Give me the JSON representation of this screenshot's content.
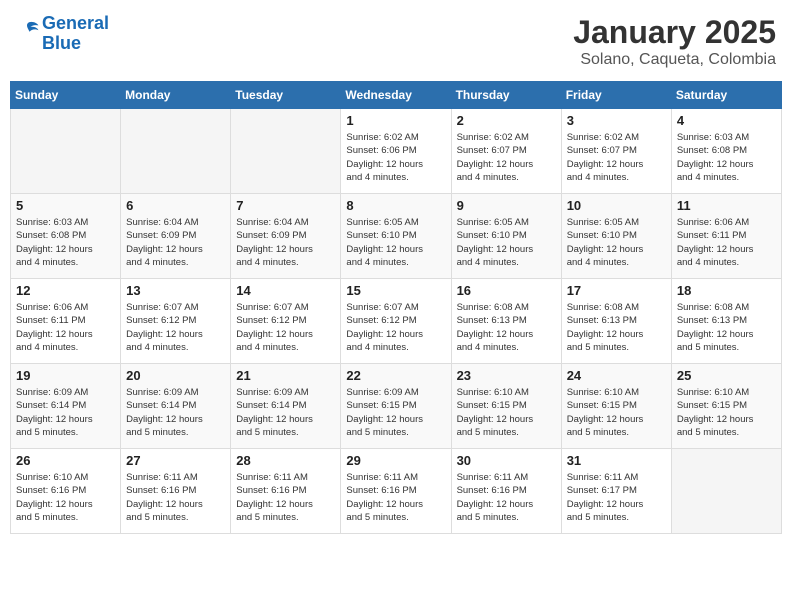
{
  "logo": {
    "line1": "General",
    "line2": "Blue"
  },
  "title": "January 2025",
  "location": "Solano, Caqueta, Colombia",
  "weekdays": [
    "Sunday",
    "Monday",
    "Tuesday",
    "Wednesday",
    "Thursday",
    "Friday",
    "Saturday"
  ],
  "weeks": [
    [
      {
        "day": "",
        "info": ""
      },
      {
        "day": "",
        "info": ""
      },
      {
        "day": "",
        "info": ""
      },
      {
        "day": "1",
        "info": "Sunrise: 6:02 AM\nSunset: 6:06 PM\nDaylight: 12 hours\nand 4 minutes."
      },
      {
        "day": "2",
        "info": "Sunrise: 6:02 AM\nSunset: 6:07 PM\nDaylight: 12 hours\nand 4 minutes."
      },
      {
        "day": "3",
        "info": "Sunrise: 6:02 AM\nSunset: 6:07 PM\nDaylight: 12 hours\nand 4 minutes."
      },
      {
        "day": "4",
        "info": "Sunrise: 6:03 AM\nSunset: 6:08 PM\nDaylight: 12 hours\nand 4 minutes."
      }
    ],
    [
      {
        "day": "5",
        "info": "Sunrise: 6:03 AM\nSunset: 6:08 PM\nDaylight: 12 hours\nand 4 minutes."
      },
      {
        "day": "6",
        "info": "Sunrise: 6:04 AM\nSunset: 6:09 PM\nDaylight: 12 hours\nand 4 minutes."
      },
      {
        "day": "7",
        "info": "Sunrise: 6:04 AM\nSunset: 6:09 PM\nDaylight: 12 hours\nand 4 minutes."
      },
      {
        "day": "8",
        "info": "Sunrise: 6:05 AM\nSunset: 6:10 PM\nDaylight: 12 hours\nand 4 minutes."
      },
      {
        "day": "9",
        "info": "Sunrise: 6:05 AM\nSunset: 6:10 PM\nDaylight: 12 hours\nand 4 minutes."
      },
      {
        "day": "10",
        "info": "Sunrise: 6:05 AM\nSunset: 6:10 PM\nDaylight: 12 hours\nand 4 minutes."
      },
      {
        "day": "11",
        "info": "Sunrise: 6:06 AM\nSunset: 6:11 PM\nDaylight: 12 hours\nand 4 minutes."
      }
    ],
    [
      {
        "day": "12",
        "info": "Sunrise: 6:06 AM\nSunset: 6:11 PM\nDaylight: 12 hours\nand 4 minutes."
      },
      {
        "day": "13",
        "info": "Sunrise: 6:07 AM\nSunset: 6:12 PM\nDaylight: 12 hours\nand 4 minutes."
      },
      {
        "day": "14",
        "info": "Sunrise: 6:07 AM\nSunset: 6:12 PM\nDaylight: 12 hours\nand 4 minutes."
      },
      {
        "day": "15",
        "info": "Sunrise: 6:07 AM\nSunset: 6:12 PM\nDaylight: 12 hours\nand 4 minutes."
      },
      {
        "day": "16",
        "info": "Sunrise: 6:08 AM\nSunset: 6:13 PM\nDaylight: 12 hours\nand 4 minutes."
      },
      {
        "day": "17",
        "info": "Sunrise: 6:08 AM\nSunset: 6:13 PM\nDaylight: 12 hours\nand 5 minutes."
      },
      {
        "day": "18",
        "info": "Sunrise: 6:08 AM\nSunset: 6:13 PM\nDaylight: 12 hours\nand 5 minutes."
      }
    ],
    [
      {
        "day": "19",
        "info": "Sunrise: 6:09 AM\nSunset: 6:14 PM\nDaylight: 12 hours\nand 5 minutes."
      },
      {
        "day": "20",
        "info": "Sunrise: 6:09 AM\nSunset: 6:14 PM\nDaylight: 12 hours\nand 5 minutes."
      },
      {
        "day": "21",
        "info": "Sunrise: 6:09 AM\nSunset: 6:14 PM\nDaylight: 12 hours\nand 5 minutes."
      },
      {
        "day": "22",
        "info": "Sunrise: 6:09 AM\nSunset: 6:15 PM\nDaylight: 12 hours\nand 5 minutes."
      },
      {
        "day": "23",
        "info": "Sunrise: 6:10 AM\nSunset: 6:15 PM\nDaylight: 12 hours\nand 5 minutes."
      },
      {
        "day": "24",
        "info": "Sunrise: 6:10 AM\nSunset: 6:15 PM\nDaylight: 12 hours\nand 5 minutes."
      },
      {
        "day": "25",
        "info": "Sunrise: 6:10 AM\nSunset: 6:15 PM\nDaylight: 12 hours\nand 5 minutes."
      }
    ],
    [
      {
        "day": "26",
        "info": "Sunrise: 6:10 AM\nSunset: 6:16 PM\nDaylight: 12 hours\nand 5 minutes."
      },
      {
        "day": "27",
        "info": "Sunrise: 6:11 AM\nSunset: 6:16 PM\nDaylight: 12 hours\nand 5 minutes."
      },
      {
        "day": "28",
        "info": "Sunrise: 6:11 AM\nSunset: 6:16 PM\nDaylight: 12 hours\nand 5 minutes."
      },
      {
        "day": "29",
        "info": "Sunrise: 6:11 AM\nSunset: 6:16 PM\nDaylight: 12 hours\nand 5 minutes."
      },
      {
        "day": "30",
        "info": "Sunrise: 6:11 AM\nSunset: 6:16 PM\nDaylight: 12 hours\nand 5 minutes."
      },
      {
        "day": "31",
        "info": "Sunrise: 6:11 AM\nSunset: 6:17 PM\nDaylight: 12 hours\nand 5 minutes."
      },
      {
        "day": "",
        "info": ""
      }
    ]
  ]
}
